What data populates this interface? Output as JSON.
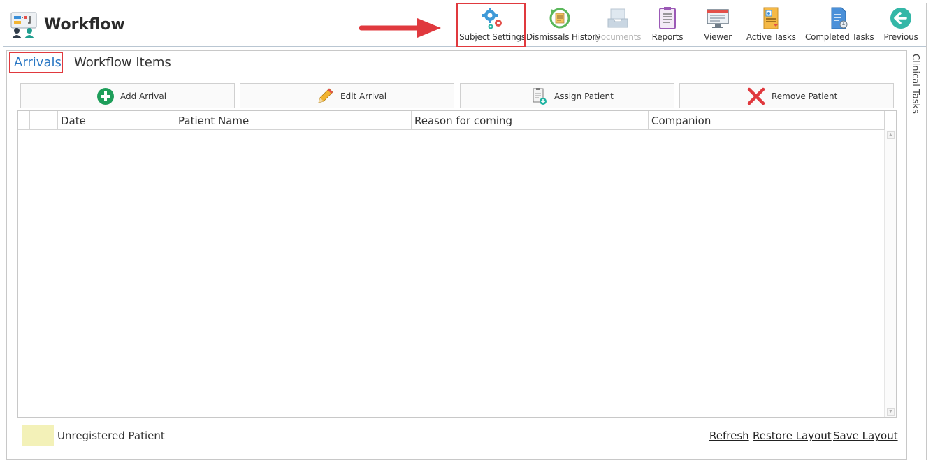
{
  "app": {
    "title": "Workflow"
  },
  "toolbar": {
    "items": [
      {
        "label": "Subject Settings",
        "icon": "gears-icon",
        "enabled": true,
        "highlighted": true
      },
      {
        "label": "Dismissals History",
        "icon": "history-icon",
        "enabled": true
      },
      {
        "label": "Documents",
        "icon": "inbox-tray-icon",
        "enabled": false
      },
      {
        "label": "Reports",
        "icon": "clipboard-report-icon",
        "enabled": true
      },
      {
        "label": "Viewer",
        "icon": "monitor-icon",
        "enabled": true
      },
      {
        "label": "Active Tasks",
        "icon": "active-tasks-icon",
        "enabled": true
      },
      {
        "label": "Completed Tasks",
        "icon": "completed-tasks-icon",
        "enabled": true
      },
      {
        "label": "Previous",
        "icon": "back-arrow-icon",
        "enabled": true
      }
    ]
  },
  "tabs": [
    {
      "label": "Arrivals",
      "active": true,
      "highlighted": true
    },
    {
      "label": "Workflow Items",
      "active": false
    }
  ],
  "actions": [
    {
      "label": "Add Arrival",
      "icon": "plus-circle-icon"
    },
    {
      "label": "Edit Arrival",
      "icon": "pencil-icon"
    },
    {
      "label": "Assign Patient",
      "icon": "assign-document-icon"
    },
    {
      "label": "Remove Patient",
      "icon": "red-x-icon"
    }
  ],
  "grid": {
    "columns": [
      "",
      "",
      "Date",
      "Patient Name",
      "Reason for coming",
      "Companion"
    ],
    "rows": []
  },
  "legend": {
    "label": "Unregistered Patient",
    "color": "#f3f1b8"
  },
  "footer_links": [
    "Refresh",
    "Restore Layout",
    "Save Layout"
  ],
  "side_panel": {
    "label": "Clinical Tasks"
  },
  "colors": {
    "accent": "#2b78c4",
    "highlight": "#e0393e"
  }
}
